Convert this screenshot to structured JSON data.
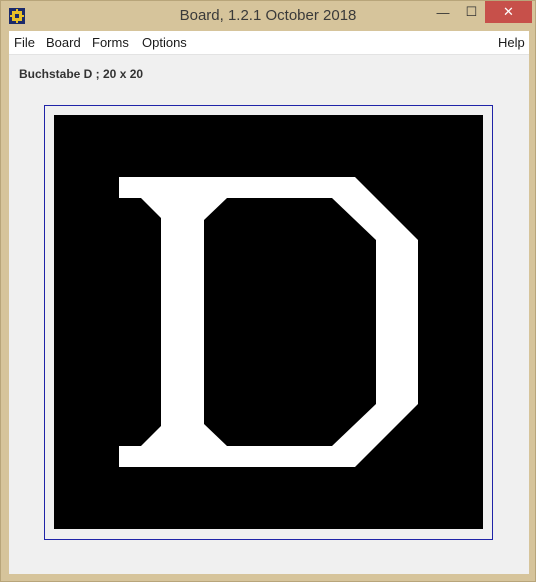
{
  "window": {
    "title": "Board, 1.2.1 October 2018",
    "controls": {
      "minimize": "—",
      "maximize": "☐",
      "close": "✕"
    }
  },
  "menu": {
    "file": "File",
    "board": "Board",
    "forms": "Forms",
    "options": "Options",
    "help": "Help"
  },
  "status": {
    "text": "Buchstabe D ; 20 x 20"
  },
  "board": {
    "glyph": "D",
    "grid_size": "20 x 20",
    "background_color": "#000000",
    "foreground_color": "#ffffff",
    "frame_color": "#1f24a8"
  }
}
